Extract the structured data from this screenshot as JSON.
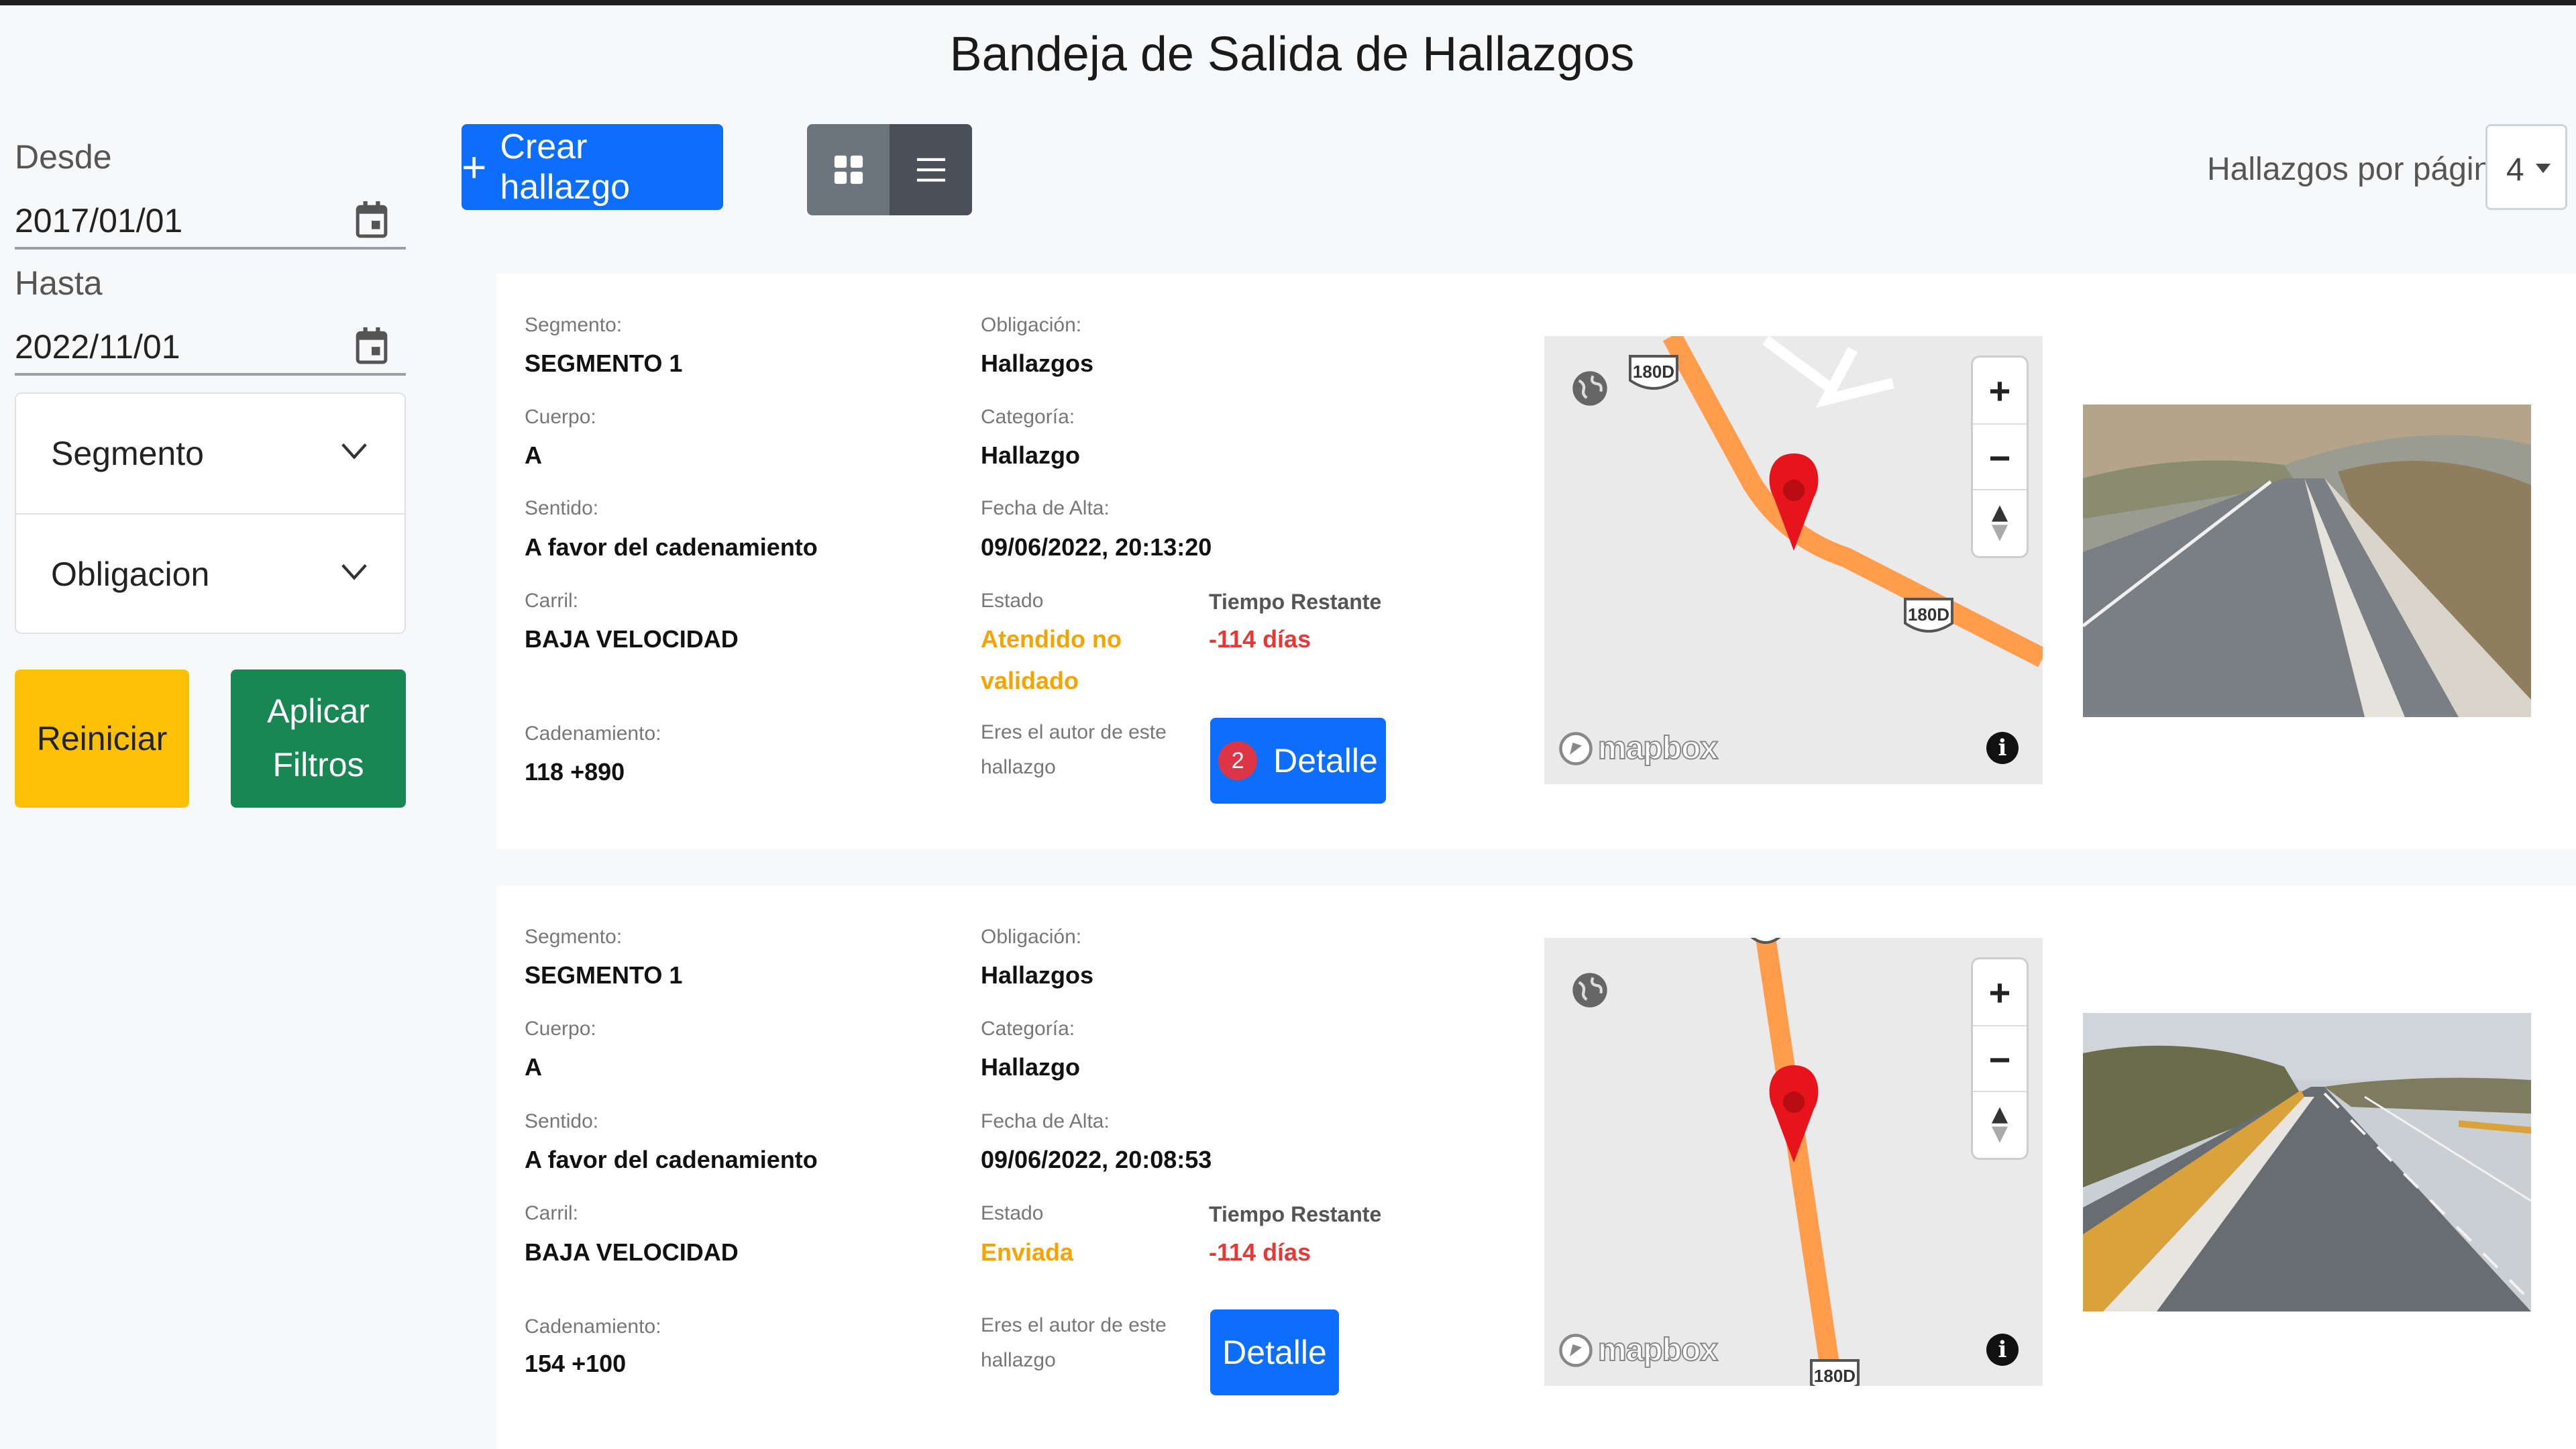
{
  "page": {
    "title": "Bandeja de Salida de Hallazgos"
  },
  "filters": {
    "from_label": "Desde",
    "from_value": "2017/01/01",
    "to_label": "Hasta",
    "to_value": "2022/11/01",
    "segment_label": "Segmento",
    "obligation_label": "Obligacion",
    "reset_label": "Reiniciar",
    "apply_label_line1": "Aplicar",
    "apply_label_line2": "Filtros"
  },
  "toolbar": {
    "create_label": "Crear hallazgo",
    "per_page_label": "Hallazgos por página:",
    "per_page_value": "4"
  },
  "labels": {
    "segment": "Segmento:",
    "body": "Cuerpo:",
    "direction": "Sentido:",
    "lane": "Carril:",
    "chainage": "Cadenamiento:",
    "obligation": "Obligación:",
    "category": "Categoría:",
    "created": "Fecha de Alta:",
    "status": "Estado",
    "time_left": "Tiempo Restante",
    "author_line1": "Eres el autor de este",
    "author_line2": "hallazgo",
    "detail": "Detalle",
    "map_attribution": "mapbox",
    "map_shield": "180D"
  },
  "colors": {
    "primary": "#0d6efd",
    "warning": "#ffc107",
    "success": "#198754",
    "route": "#ff9d4d",
    "marker": "#e8141b"
  },
  "findings": [
    {
      "segment": "SEGMENTO 1",
      "body": "A",
      "direction": "A favor del cadenamiento",
      "lane": "BAJA VELOCIDAD",
      "chainage": "118 +890",
      "obligation": "Hallazgos",
      "category": "Hallazgo",
      "created": "09/06/2022, 20:13:20",
      "status_line1": "Atendido no",
      "status_line2": "validado",
      "time_left": "-114 días",
      "badge": "2",
      "photo_desc": "road-with-concrete-curb"
    },
    {
      "segment": "SEGMENTO 1",
      "body": "A",
      "direction": "A favor del cadenamiento",
      "lane": "BAJA VELOCIDAD",
      "chainage": "154 +100",
      "obligation": "Hallazgos",
      "category": "Hallazgo",
      "created": "09/06/2022, 20:08:53",
      "status_line1": "Enviada",
      "status_line2": "",
      "time_left": "-114 días",
      "badge": "",
      "photo_desc": "road-with-guardrail"
    }
  ]
}
